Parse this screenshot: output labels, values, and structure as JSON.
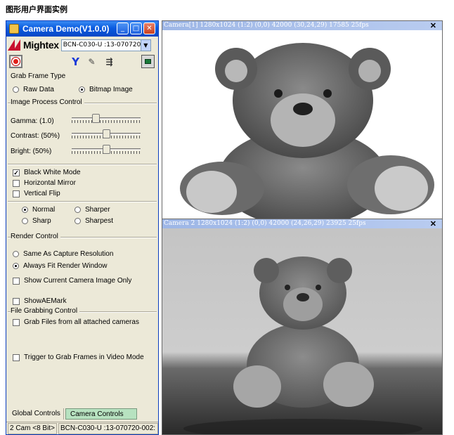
{
  "page_heading": "图形用户界面实例",
  "panel": {
    "title": "Camera Demo(V1.0.0)",
    "logo_text": "Mightex",
    "camera_select": "BCN-C030-U  :13-070720-",
    "grab_frame_type": {
      "label": "Grab Frame Type",
      "options": [
        {
          "label": "Raw Data",
          "selected": false
        },
        {
          "label": "Bitmap Image",
          "selected": true
        }
      ]
    },
    "image_process": {
      "label": "Image Process Control",
      "sliders": [
        {
          "label": "Gamma: (1.0)",
          "level": 0.33
        },
        {
          "label": "Contrast: (50%)",
          "level": 0.5
        },
        {
          "label": "Bright: (50%)",
          "level": 0.5
        }
      ]
    },
    "checks": [
      {
        "label": "Black White Mode",
        "checked": true
      },
      {
        "label": "Horizontal Mirror",
        "checked": false
      },
      {
        "label": "Vertical Flip",
        "checked": false
      }
    ],
    "sharpness": [
      {
        "label": "Normal",
        "selected": true
      },
      {
        "label": "Sharper",
        "selected": false
      },
      {
        "label": "Sharp",
        "selected": false
      },
      {
        "label": "Sharpest",
        "selected": false
      }
    ],
    "render_control": {
      "label": "Render Control",
      "options": [
        {
          "label": "Same As Capture Resolution",
          "selected": false
        },
        {
          "label": "Always Fit Render Window",
          "selected": true
        }
      ],
      "show_current": {
        "label": "Show Current Camera Image Only",
        "checked": false
      },
      "show_ae_mark": {
        "label": "ShowAEMark",
        "checked": false
      }
    },
    "file_grabbing": {
      "label": "File Grabbing Control",
      "grab_all": {
        "label": "Grab Files from all attached cameras",
        "checked": false
      },
      "trigger": {
        "label": "Trigger to Grab Frames in Video Mode",
        "checked": false
      }
    },
    "tabs": {
      "global": "Global Controls",
      "camera": "Camera Controls"
    },
    "status": {
      "left": "2 Cam <8 Bit>",
      "right": "BCN-C030-U  :13-070720-002:"
    }
  },
  "camera_windows": [
    {
      "title": "Camera[1]  1280x1024 (1:2) (0,0) 42000 (30,24,29) 17585 25fps"
    },
    {
      "title": "Camera 2   1280x1024 (1:2) (0,0) 42000 (24,26,29) 23925 25fps"
    }
  ],
  "colors": {
    "titlebar": "#0a5be0",
    "logo_red": "#c8102e",
    "tab_active": "#b7e2c0",
    "cam_title": "#9db6e6"
  },
  "icons": [
    "camera-app-icon",
    "record-icon",
    "y-tool-icon",
    "wand-icon",
    "network-icon",
    "stop-icon"
  ]
}
